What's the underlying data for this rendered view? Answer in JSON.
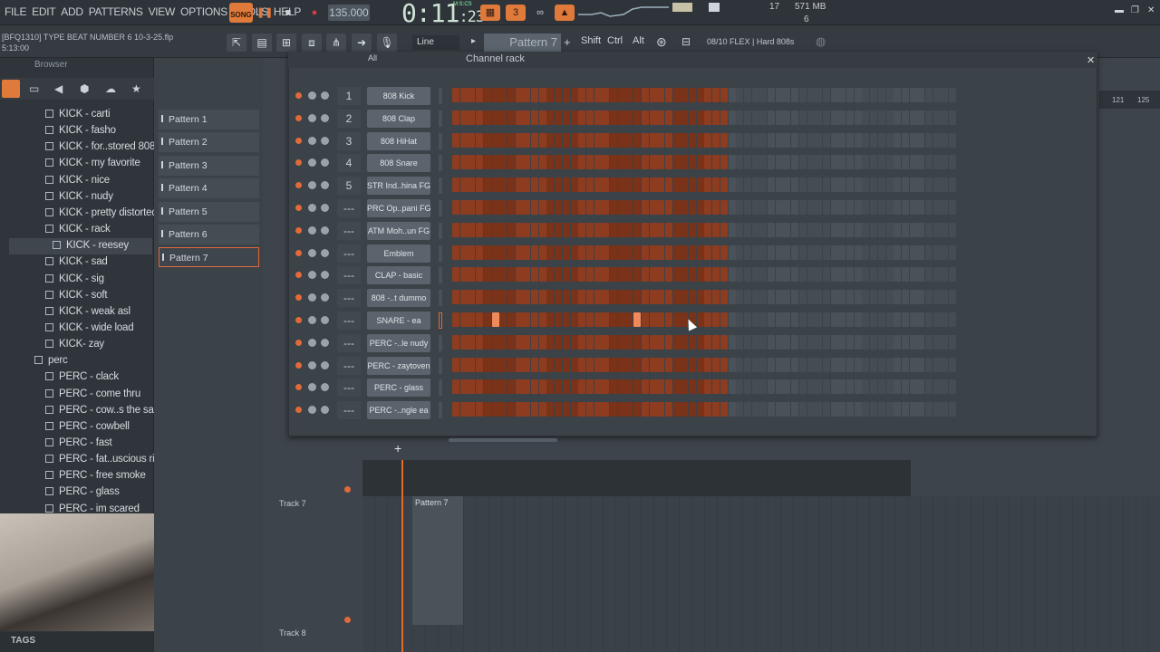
{
  "menu": {
    "items": [
      "FILE",
      "EDIT",
      "ADD",
      "PATTERNS",
      "VIEW",
      "OPTIONS",
      "TOOLS",
      "HELP"
    ]
  },
  "transport": {
    "song_label": "SONG",
    "bpm": "135.000",
    "time_main": "0:11",
    "time_sub": ":23",
    "time_unit": "M:S:CS"
  },
  "status": {
    "cpu": "17",
    "memory": "571 MB",
    "polyphony": "6"
  },
  "project": {
    "filename": "[BFQ1310] TYPE BEAT NUMBER 6 10-3-25.flp",
    "time": "5:13:00"
  },
  "toolbar2": {
    "snap": "Line",
    "pattern": "Pattern 7",
    "modifiers": [
      "Shift",
      "Ctrl",
      "Alt"
    ],
    "hint": "08/10  FLEX | Hard 808s"
  },
  "browser": {
    "title": "Browser",
    "items": [
      "KICK - carti",
      "KICK - fasho",
      "KICK - for..stored 808",
      "KICK - my favorite",
      "KICK - nice",
      "KICK - nudy",
      "KICK - pretty distorted",
      "KICK - rack",
      "KICK - reesey",
      "KICK - sad",
      "KICK - sig",
      "KICK - soft",
      "KICK - weak asl",
      "KICK - wide load",
      "KICK- zay",
      "perc",
      "PERC - clack",
      "PERC - come thru",
      "PERC - cow..s the same",
      "PERC - cowbell",
      "PERC - fast",
      "PERC - fat..uscious rim",
      "PERC - free smoke",
      "PERC - glass",
      "PERC - im scared"
    ],
    "tags_label": "TAGS"
  },
  "patterns": [
    "Pattern 1",
    "Pattern 2",
    "Pattern 3",
    "Pattern 4",
    "Pattern 5",
    "Pattern 6",
    "Pattern 7"
  ],
  "channel_rack": {
    "title": "Channel rack",
    "filter": "All",
    "channels": [
      {
        "num": "1",
        "name": "808 Kick"
      },
      {
        "num": "2",
        "name": "808 Clap"
      },
      {
        "num": "3",
        "name": "808 HiHat"
      },
      {
        "num": "4",
        "name": "808 Snare"
      },
      {
        "num": "5",
        "name": "STR Ind..hina FG"
      },
      {
        "num": "---",
        "name": "PRC Op..pani FG"
      },
      {
        "num": "---",
        "name": "ATM Moh..un FG"
      },
      {
        "num": "---",
        "name": "Emblem"
      },
      {
        "num": "---",
        "name": "CLAP - basic"
      },
      {
        "num": "---",
        "name": "808 -..t dummo"
      },
      {
        "num": "---",
        "name": "SNARE - ea"
      },
      {
        "num": "---",
        "name": "PERC -..le nudy"
      },
      {
        "num": "---",
        "name": "PERC - zaytoven"
      },
      {
        "num": "---",
        "name": "PERC - glass"
      },
      {
        "num": "---",
        "name": "PERC -..ngle ea"
      }
    ],
    "active_steps": {
      "row": 10,
      "steps": [
        5,
        23
      ]
    }
  },
  "playlist": {
    "tracks": [
      "Track 7",
      "Track 8"
    ],
    "clip": "Pattern 7",
    "ruler": [
      "121",
      "125"
    ]
  },
  "colors": {
    "accent": "#e0693a",
    "step_on": "#f08a5a",
    "step_off": "#8a3a1f"
  }
}
